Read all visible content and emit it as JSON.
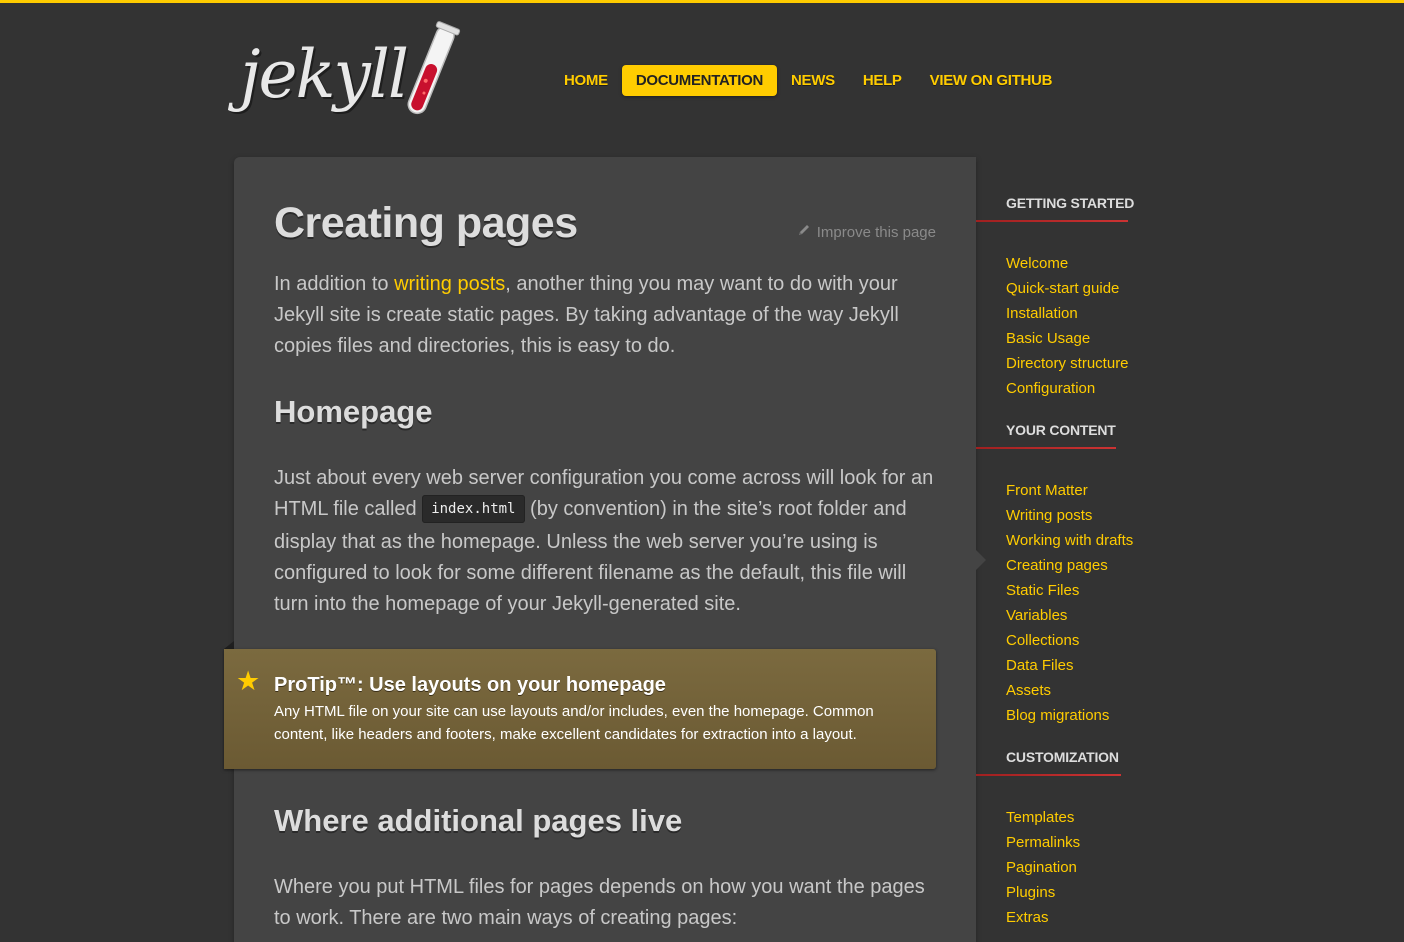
{
  "header": {
    "logo_text": "jekyll",
    "nav": [
      {
        "label": "HOME",
        "active": false
      },
      {
        "label": "DOCUMENTATION",
        "active": true
      },
      {
        "label": "NEWS",
        "active": false
      },
      {
        "label": "HELP",
        "active": false
      },
      {
        "label": "VIEW ON GITHUB",
        "active": false
      }
    ]
  },
  "main": {
    "title": "Creating pages",
    "improve_label": "Improve this page",
    "intro_before": "In addition to ",
    "intro_link": "writing posts",
    "intro_after": ", another thing you may want to do with your Jekyll site is create static pages. By taking advantage of the way Jekyll copies files and directories, this is easy to do.",
    "homepage_heading": "Homepage",
    "homepage_before": "Just about every web server configuration you come across will look for an HTML file called ",
    "homepage_code": "index.html",
    "homepage_after": " (by convention) in the site’s root folder and display that as the homepage. Unless the web server you’re using is configured to look for some different filename as the default, this file will turn into the homepage of your Jekyll-generated site.",
    "protip": {
      "icon": "star-icon",
      "title": "ProTip™: Use layouts on your homepage",
      "body": "Any HTML file on your site can use layouts and/or includes, even the homepage. Common content, like headers and footers, make excellent candidates for extraction into a layout."
    },
    "additional_heading": "Where additional pages live",
    "additional_text": "Where you put HTML files for pages depends on how you want the pages to work. There are two main ways of creating pages:"
  },
  "sidebar": {
    "sections": [
      {
        "heading": "GETTING STARTED",
        "items": [
          "Welcome",
          "Quick-start guide",
          "Installation",
          "Basic Usage",
          "Directory structure",
          "Configuration"
        ]
      },
      {
        "heading": "YOUR CONTENT",
        "items": [
          "Front Matter",
          "Writing posts",
          "Working with drafts",
          "Creating pages",
          "Static Files",
          "Variables",
          "Collections",
          "Data Files",
          "Assets",
          "Blog migrations"
        ]
      },
      {
        "heading": "CUSTOMIZATION",
        "items": [
          "Templates",
          "Permalinks",
          "Pagination",
          "Plugins",
          "Extras"
        ]
      }
    ]
  },
  "colors": {
    "background": "#333333",
    "card": "#444444",
    "accent": "#ffcc00",
    "protip": "#7b6a3f",
    "rule": "#cc3333"
  }
}
